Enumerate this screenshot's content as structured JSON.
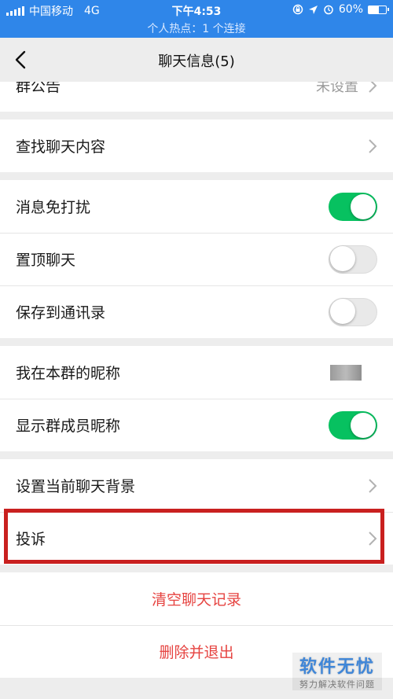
{
  "status_bar": {
    "carrier": "中国移动",
    "network": "4G",
    "time": "下午4:53",
    "battery": "60%",
    "battery_level": 0.6,
    "hotspot": "个人热点：1 个连接"
  },
  "navbar": {
    "title": "聊天信息(5)"
  },
  "settings": {
    "announcement": {
      "label": "群公告",
      "value": "未设置"
    },
    "search_history": {
      "label": "查找聊天内容"
    },
    "mute": {
      "label": "消息免打扰",
      "on": true
    },
    "pin": {
      "label": "置顶聊天",
      "on": false
    },
    "save_contacts": {
      "label": "保存到通讯录",
      "on": false
    },
    "my_nickname": {
      "label": "我在本群的昵称"
    },
    "show_nicknames": {
      "label": "显示群成员昵称",
      "on": true
    },
    "background": {
      "label": "设置当前聊天背景"
    },
    "report": {
      "label": "投诉"
    }
  },
  "actions": {
    "clear_history": "清空聊天记录",
    "delete_exit": "删除并退出"
  },
  "watermark": {
    "main": "软件无忧",
    "sub": "努力解决软件问题"
  },
  "colors": {
    "status_bar": "#2f86e9",
    "toggle_on": "#07c160",
    "danger": "#e64340",
    "highlight": "#c9201f"
  }
}
